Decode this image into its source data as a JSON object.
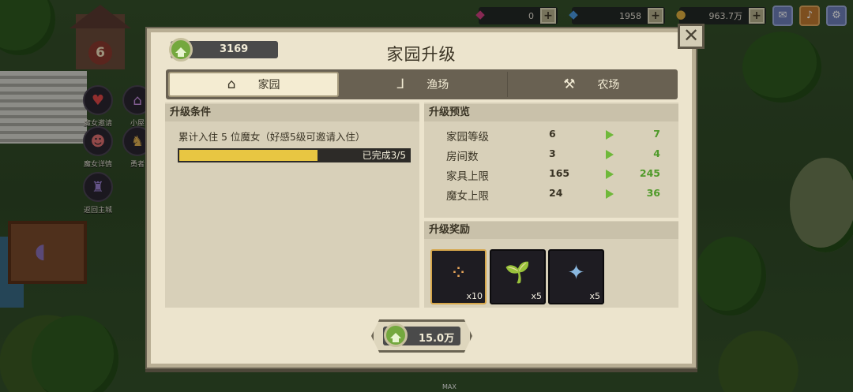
{
  "scene": {
    "house_number": "6",
    "side_icons": [
      {
        "label": "魔女邀请",
        "icon": "heart-icon"
      },
      {
        "label": "小屋",
        "icon": "house-icon"
      },
      {
        "label": "魔女详情",
        "icon": "witch-icon"
      },
      {
        "label": "勇者",
        "icon": "hero-icon"
      },
      {
        "label": "返回主城",
        "icon": "castle-icon"
      }
    ],
    "max_label": "MAX"
  },
  "topbar": {
    "ruby": "0",
    "diamond": "1958",
    "gold": "963.7万"
  },
  "dialog": {
    "title": "家园升级",
    "currency_balance": "3169",
    "close": "✕",
    "tabs": [
      {
        "label": "家园",
        "icon": "house-outline-icon",
        "glyph": "⌂"
      },
      {
        "label": "渔场",
        "icon": "fishing-hook-icon",
        "glyph": "⅃"
      },
      {
        "label": "农场",
        "icon": "shovel-icon",
        "glyph": "⚒"
      }
    ],
    "requirements": {
      "heading": "升级条件",
      "text": "累计入住 5 位魔女（好感5级可邀请入住）",
      "progress_text": "已完成3/5",
      "progress_fraction": 0.6
    },
    "preview": {
      "heading": "升级预览",
      "rows": [
        {
          "label": "家园等级",
          "current": "6",
          "next": "7"
        },
        {
          "label": "房间数",
          "current": "3",
          "next": "4"
        },
        {
          "label": "家具上限",
          "current": "165",
          "next": "245"
        },
        {
          "label": "魔女上限",
          "current": "24",
          "next": "36"
        }
      ]
    },
    "rewards": {
      "heading": "升级奖励",
      "items": [
        {
          "qty": "x10",
          "icon": "seeds-icon",
          "glyph": "⁘",
          "color": "#e8a55a"
        },
        {
          "qty": "x5",
          "icon": "sprout-pot-icon",
          "glyph": "🌱",
          "color": "#8fc454"
        },
        {
          "qty": "x5",
          "icon": "treasure-chest-icon",
          "glyph": "✦",
          "color": "#8ab8e0"
        }
      ]
    },
    "upgrade_cost": "15.0万"
  },
  "colors": {
    "accent_green": "#74a83e",
    "progress_yellow": "#e8c642",
    "next_value_green": "#4f9a2a"
  }
}
